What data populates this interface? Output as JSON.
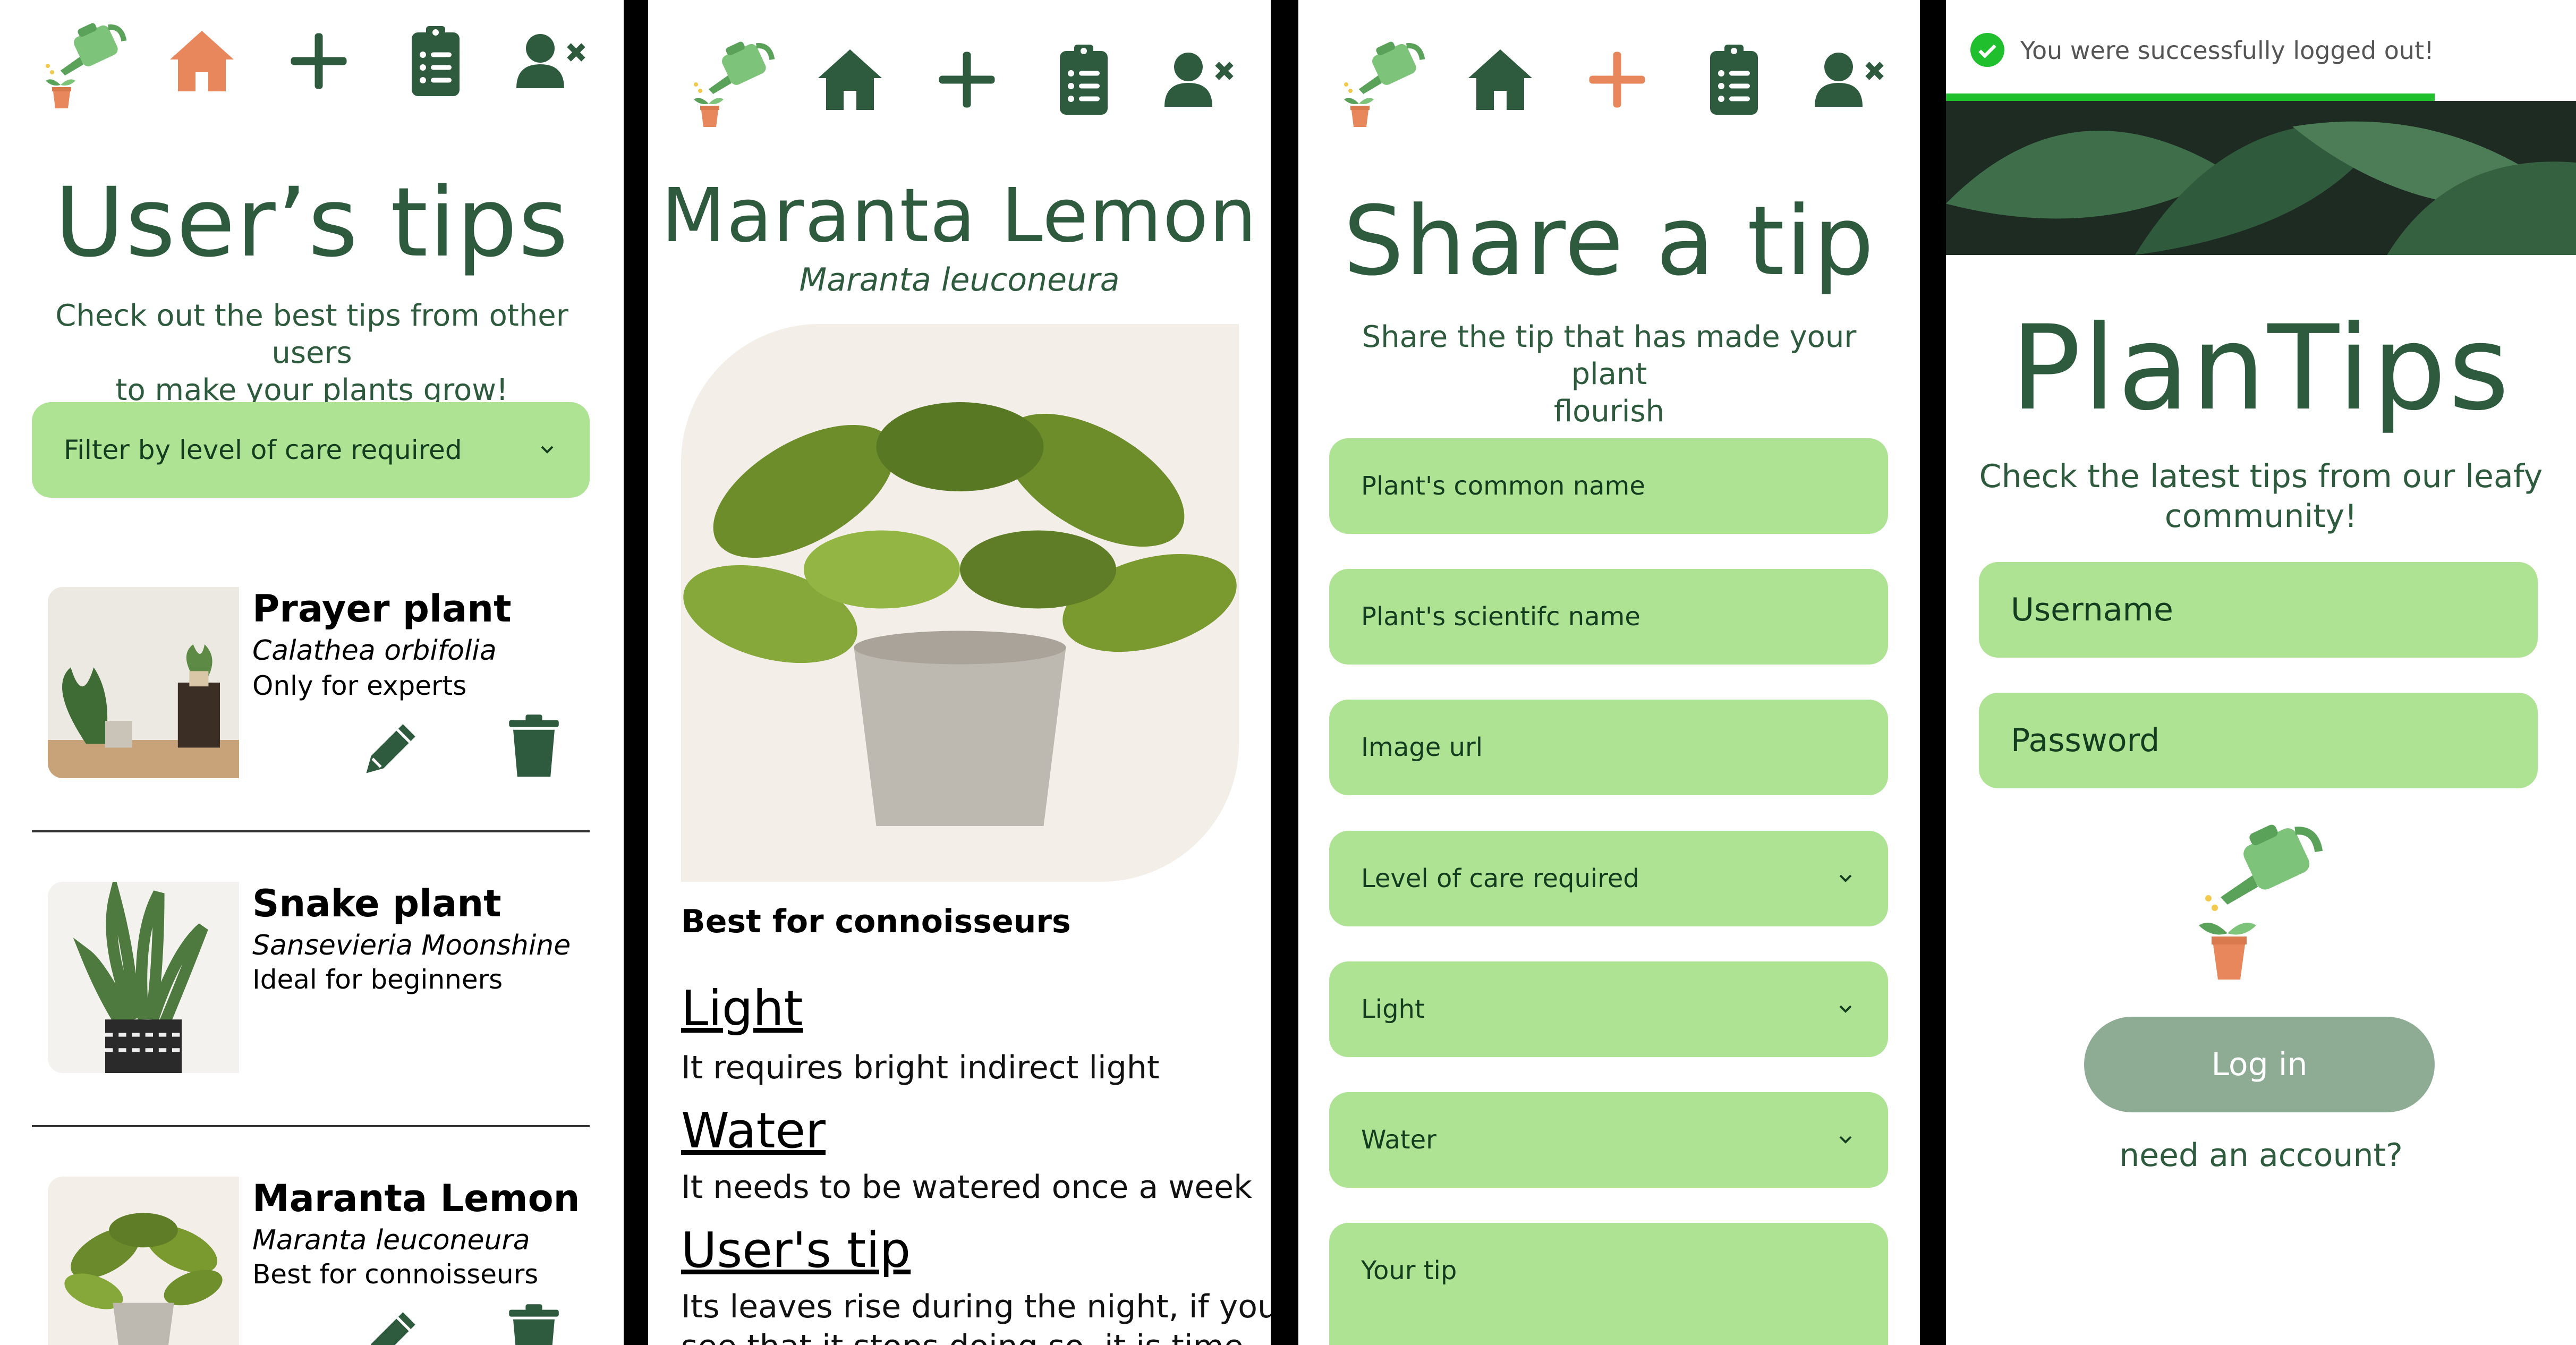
{
  "nav": {
    "icons": [
      "watering-can-logo-icon",
      "home-icon",
      "plus-icon",
      "clipboard-icon",
      "user-remove-icon"
    ],
    "colors": {
      "dark": "#2e5b3d",
      "accent": "#e8875b"
    }
  },
  "users_tips": {
    "title": "User’s tips",
    "subtitle_line1": "Check out the best tips from other users",
    "subtitle_line2": "to make your plants grow!",
    "filter_label": "Filter by level of care required",
    "cards": [
      {
        "name": "Prayer plant",
        "scientific": "Calathea orbifolia",
        "level": "Only for experts"
      },
      {
        "name": "Snake plant",
        "scientific": "Sansevieria Moonshine",
        "level": "Ideal for beginners"
      },
      {
        "name": "Maranta Lemon",
        "scientific": "Maranta leuconeura",
        "level": "Best for connoisseurs"
      }
    ]
  },
  "detail": {
    "title": "Maranta Lemon",
    "scientific": "Maranta leuconeura",
    "care_level": "Best for connoisseurs",
    "light_heading": "Light",
    "light_text": "It requires bright indirect light",
    "water_heading": "Water",
    "water_text": "It needs to be watered once a week",
    "tip_heading": "User's tip",
    "tip_text_line1": "Its leaves rise during the night, if you",
    "tip_text_line2": "see that it stops doing so, it is time"
  },
  "share": {
    "title": "Share a tip",
    "subtitle_line1": "Share the tip that has made your plant",
    "subtitle_line2": "flourish",
    "fields": {
      "common_name": "Plant's common name",
      "scientific_name": "Plant's scientifc name",
      "image_url": "Image url",
      "care_level": "Level of care required",
      "light": "Light",
      "water": "Water",
      "tip": "Your tip"
    }
  },
  "login": {
    "toast": "You were successfully logged out!",
    "title": "PlanTips",
    "subtitle_line1": "Check the latest tips from our leafy",
    "subtitle_line2": "community!",
    "username_placeholder": "Username",
    "password_placeholder": "Password",
    "login_button": "Log in",
    "need_account": "need an account?"
  }
}
